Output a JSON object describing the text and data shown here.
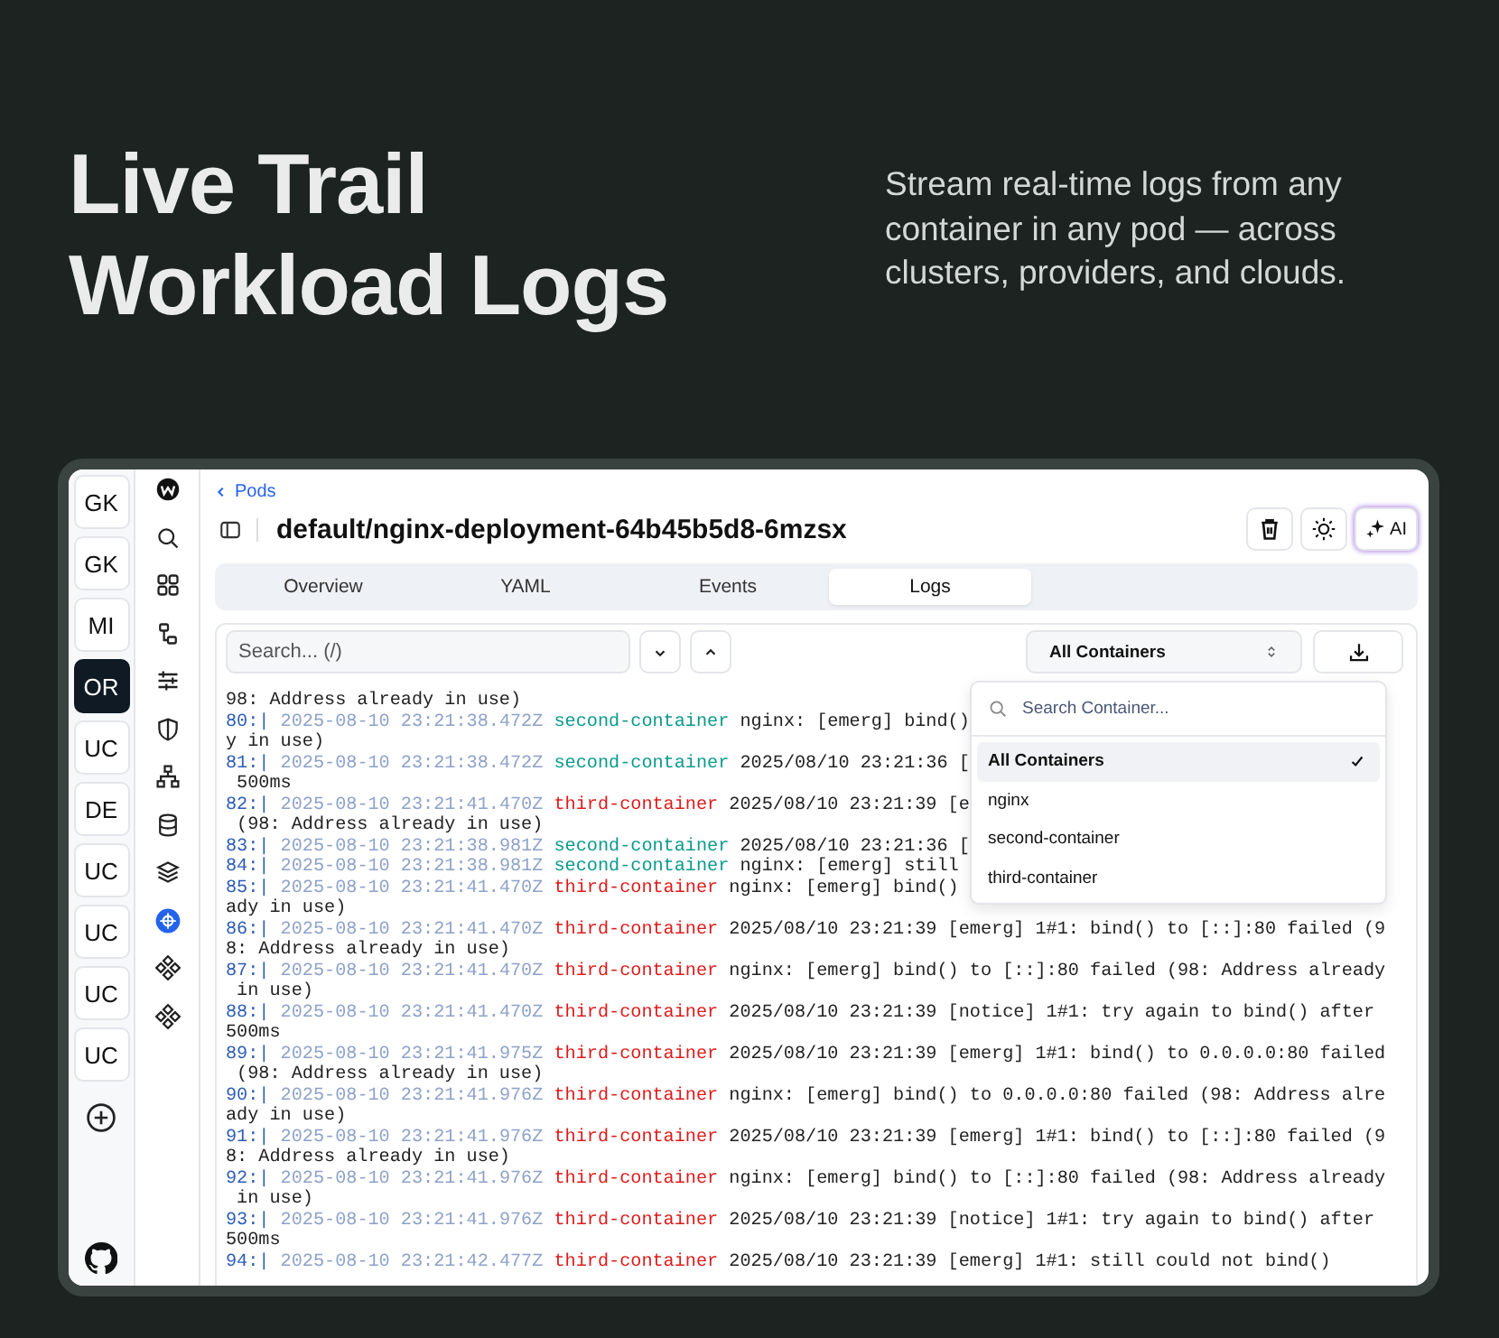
{
  "hero": {
    "title_lines": [
      "Live Trail",
      "Workload Logs"
    ],
    "tagline": "Stream real-time logs from any container in any pod — across clusters, providers, and clouds."
  },
  "clusters": [
    {
      "label": "GK",
      "selected": false
    },
    {
      "label": "GK",
      "selected": false
    },
    {
      "label": "MI",
      "selected": false
    },
    {
      "label": "OR",
      "selected": true
    },
    {
      "label": "UC",
      "selected": false
    },
    {
      "label": "DE",
      "selected": false
    },
    {
      "label": "UC",
      "selected": false
    },
    {
      "label": "UC",
      "selected": false
    },
    {
      "label": "UC",
      "selected": false
    },
    {
      "label": "UC",
      "selected": false
    }
  ],
  "nav_items": [
    {
      "kind": "search",
      "selected": false
    },
    {
      "kind": "grid",
      "selected": false
    },
    {
      "kind": "diagram",
      "selected": false
    },
    {
      "kind": "sliders",
      "selected": false
    },
    {
      "kind": "shield",
      "selected": false
    },
    {
      "kind": "network",
      "selected": false
    },
    {
      "kind": "database",
      "selected": false
    },
    {
      "kind": "layers",
      "selected": false
    },
    {
      "kind": "helm",
      "selected": true
    },
    {
      "kind": "cluster",
      "selected": false
    },
    {
      "kind": "cluster",
      "selected": false
    }
  ],
  "breadcrumb": "Pods",
  "title": "default/nginx-deployment-64b45b5d8-6mzsx",
  "ai_button": "AI",
  "tabs": [
    {
      "label": "Overview",
      "selected": false
    },
    {
      "label": "YAML",
      "selected": false
    },
    {
      "label": "Events",
      "selected": false
    },
    {
      "label": "Logs",
      "selected": true
    }
  ],
  "search": {
    "placeholder": "Search... (/)"
  },
  "container_select": {
    "value": "All Containers"
  },
  "dropdown": {
    "placeholder": "Search Container...",
    "options": [
      {
        "label": "All Containers",
        "selected": true
      },
      {
        "label": "nginx",
        "selected": false
      },
      {
        "label": "second-container",
        "selected": false
      },
      {
        "label": "third-container",
        "selected": false
      }
    ]
  },
  "log_head": "98: Address already in use)",
  "logs": [
    {
      "line": "80:|",
      "timestamp": "2025-08-10 23:21:38.472Z",
      "container": "second-container",
      "color": "#0b9a8c",
      "text": "nginx: [emerg] bind()",
      "wrap": "y in use)"
    },
    {
      "line": "81:|",
      "timestamp": "2025-08-10 23:21:38.472Z",
      "container": "second-container",
      "color": "#0b9a8c",
      "text": "2025/08/10 23:21:36 [",
      "wrap": " 500ms"
    },
    {
      "line": "82:|",
      "timestamp": "2025-08-10 23:21:41.470Z",
      "container": "third-container",
      "color": "#dd1b1b",
      "text": "2025/08/10 23:21:39 [e",
      "wrap": " (98: Address already in use)"
    },
    {
      "line": "83:|",
      "timestamp": "2025-08-10 23:21:38.981Z",
      "container": "second-container",
      "color": "#0b9a8c",
      "text": "2025/08/10 23:21:36 ["
    },
    {
      "line": "84:|",
      "timestamp": "2025-08-10 23:21:38.981Z",
      "container": "second-container",
      "color": "#0b9a8c",
      "text": "nginx: [emerg] still "
    },
    {
      "line": "85:|",
      "timestamp": "2025-08-10 23:21:41.470Z",
      "container": "third-container",
      "color": "#dd1b1b",
      "text": "nginx: [emerg] bind() ",
      "wrap": "ady in use)"
    },
    {
      "line": "86:|",
      "timestamp": "2025-08-10 23:21:41.470Z",
      "container": "third-container",
      "color": "#dd1b1b",
      "text": "2025/08/10 23:21:39 [emerg] 1#1: bind() to [::]:80 failed (9",
      "wrap": "8: Address already in use)"
    },
    {
      "line": "87:|",
      "timestamp": "2025-08-10 23:21:41.470Z",
      "container": "third-container",
      "color": "#dd1b1b",
      "text": "nginx: [emerg] bind() to [::]:80 failed (98: Address already",
      "wrap": " in use)"
    },
    {
      "line": "88:|",
      "timestamp": "2025-08-10 23:21:41.470Z",
      "container": "third-container",
      "color": "#dd1b1b",
      "text": "2025/08/10 23:21:39 [notice] 1#1: try again to bind() after",
      "wrap": "500ms"
    },
    {
      "line": "89:|",
      "timestamp": "2025-08-10 23:21:41.975Z",
      "container": "third-container",
      "color": "#dd1b1b",
      "text": "2025/08/10 23:21:39 [emerg] 1#1: bind() to 0.0.0.0:80 failed",
      "wrap": " (98: Address already in use)"
    },
    {
      "line": "90:|",
      "timestamp": "2025-08-10 23:21:41.976Z",
      "container": "third-container",
      "color": "#dd1b1b",
      "text": "nginx: [emerg] bind() to 0.0.0.0:80 failed (98: Address alre",
      "wrap": "ady in use)"
    },
    {
      "line": "91:|",
      "timestamp": "2025-08-10 23:21:41.976Z",
      "container": "third-container",
      "color": "#dd1b1b",
      "text": "2025/08/10 23:21:39 [emerg] 1#1: bind() to [::]:80 failed (9",
      "wrap": "8: Address already in use)"
    },
    {
      "line": "92:|",
      "timestamp": "2025-08-10 23:21:41.976Z",
      "container": "third-container",
      "color": "#dd1b1b",
      "text": "nginx: [emerg] bind() to [::]:80 failed (98: Address already",
      "wrap": " in use)"
    },
    {
      "line": "93:|",
      "timestamp": "2025-08-10 23:21:41.976Z",
      "container": "third-container",
      "color": "#dd1b1b",
      "text": "2025/08/10 23:21:39 [notice] 1#1: try again to bind() after",
      "wrap": "500ms"
    },
    {
      "line": "94:|",
      "timestamp": "2025-08-10 23:21:42.477Z",
      "container": "third-container",
      "color": "#dd1b1b",
      "text": "2025/08/10 23:21:39 [emerg] 1#1: still could not bind()"
    }
  ]
}
